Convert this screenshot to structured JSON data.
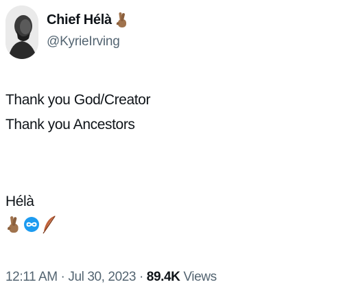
{
  "author": {
    "display_name": "Chief Hélà",
    "name_emoji": "crossed-fingers-medium-dark-skin-icon",
    "handle": "@KyrieIrving"
  },
  "tweet": {
    "lines": [
      "Thank you God/Creator",
      "Thank you Ancestors",
      "",
      "Hélà"
    ],
    "emojis": [
      "crossed-fingers-medium-dark-skin-icon",
      "infinity-icon",
      "feather-icon"
    ]
  },
  "meta": {
    "time": "12:11 AM",
    "separator1": " · ",
    "date": "Jul 30, 2023",
    "separator2": " · ",
    "views_count": "89.4K",
    "views_label": " Views"
  },
  "colors": {
    "text_primary": "#0f1419",
    "text_secondary": "#536471",
    "infinity_blue": "#1d9bf0",
    "skin_tone": "#a0734d"
  }
}
